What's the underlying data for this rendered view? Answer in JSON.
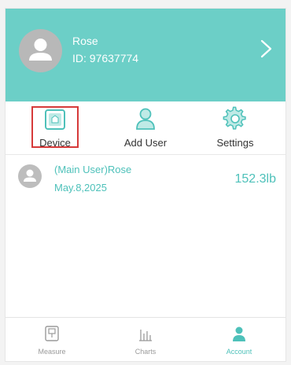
{
  "colors": {
    "accent": "#6ccfc7",
    "accent_text": "#4ec1ba",
    "highlight": "#d63a3a"
  },
  "header": {
    "name": "Rose",
    "id_text": "ID: 97637774"
  },
  "actions": [
    {
      "label": "Device",
      "icon": "device-icon",
      "highlighted": true
    },
    {
      "label": "Add User",
      "icon": "add-user-icon"
    },
    {
      "label": "Settings",
      "icon": "gear-icon"
    }
  ],
  "user_entry": {
    "name": "(Main User)Rose",
    "date": "May.8,2025",
    "weight": "152.3lb"
  },
  "bottom_nav": [
    {
      "label": "Measure",
      "icon": "scale-icon",
      "active": false
    },
    {
      "label": "Charts",
      "icon": "bar-chart-icon",
      "active": false
    },
    {
      "label": "Account",
      "icon": "account-icon",
      "active": true
    }
  ]
}
